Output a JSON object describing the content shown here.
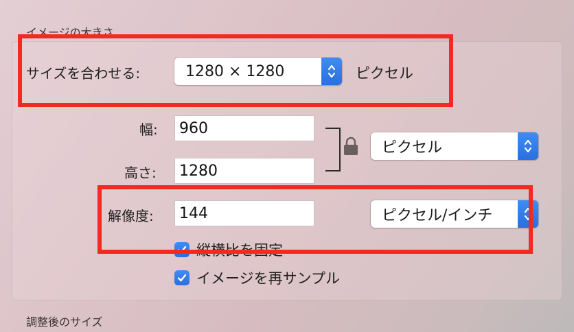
{
  "sections": {
    "image_size_title": "イメージの大きさ",
    "resulting_size_title": "調整後のサイズ"
  },
  "fit": {
    "label": "サイズを合わせる:",
    "value": "1280 × 1280",
    "unit": "ピクセル"
  },
  "width": {
    "label": "幅:",
    "value": "960"
  },
  "height": {
    "label": "高さ:",
    "value": "1280"
  },
  "size_unit": {
    "value": "ピクセル"
  },
  "resolution": {
    "label": "解像度:",
    "value": "144",
    "unit": "ピクセル/インチ"
  },
  "options": {
    "scale_proportionally": "縦横比を固定",
    "resample": "イメージを再サンプル"
  },
  "checkboxes": {
    "scale_proportionally_checked": true,
    "resample_checked": true
  },
  "icons": {
    "lock": "lock-icon",
    "stepper": "up-down-chevron-icon",
    "check": "checkmark-icon"
  },
  "colors": {
    "accent": "#2f7bf0",
    "highlight_box": "#f22a1f"
  }
}
